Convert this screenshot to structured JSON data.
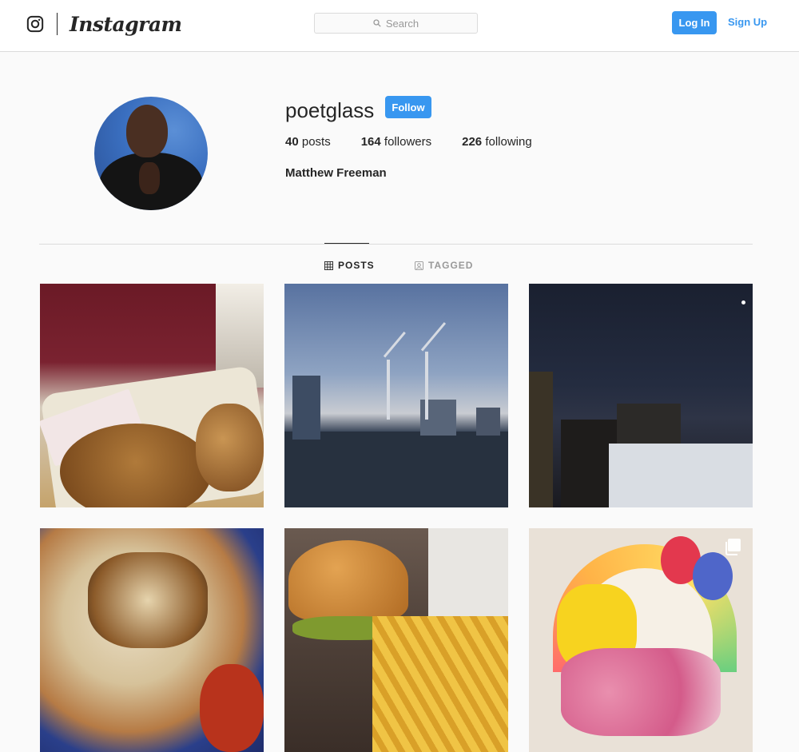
{
  "topbar": {
    "brand_name": "Instagram",
    "search_placeholder": "Search",
    "login_label": "Log In",
    "signup_label": "Sign Up"
  },
  "profile": {
    "username": "poetglass",
    "follow_label": "Follow",
    "stats": {
      "posts_count": "40",
      "posts_label": "posts",
      "followers_count": "164",
      "followers_label": "followers",
      "following_count": "226",
      "following_label": "following"
    },
    "full_name": "Matthew Freeman"
  },
  "tabs": {
    "posts_label": "POSTS",
    "tagged_label": "TAGGED",
    "active": "POSTS"
  },
  "grid": {
    "posts": [
      {
        "subject": "pastry"
      },
      {
        "subject": "cranes"
      },
      {
        "subject": "night-city"
      },
      {
        "subject": "pizza"
      },
      {
        "subject": "burger"
      },
      {
        "subject": "pokemon",
        "multi": true
      }
    ]
  },
  "colors": {
    "accent": "#3897f0",
    "border": "#dbdbdb",
    "background": "#fafafa",
    "text": "#262626",
    "muted": "#999999"
  },
  "icons": [
    "instagram-glyph-icon",
    "search-icon",
    "grid-icon",
    "tagged-icon",
    "multiple-posts-icon"
  ]
}
